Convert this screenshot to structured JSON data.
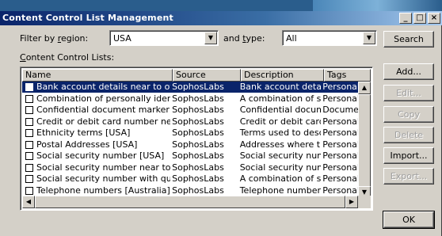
{
  "window": {
    "title": "Content Control List Management",
    "controls": {
      "minimize": "_",
      "maximize": "□",
      "close": "×"
    }
  },
  "filter": {
    "region_label_prefix": "Filter by ",
    "region_label_key": "r",
    "region_label_suffix": "egion:",
    "region_value": "USA",
    "type_label_prefix": "and ",
    "type_label_key": "t",
    "type_label_suffix": "ype:",
    "type_value": "All"
  },
  "list_label": {
    "key": "C",
    "rest": "ontent Control Lists:"
  },
  "columns": [
    "Name",
    "Source",
    "Description",
    "Tags"
  ],
  "rows": [
    {
      "name": "Bank account details near to other f...",
      "source": "SophosLabs",
      "description": "Bank account detail...",
      "tags": "Personally",
      "selected": true
    },
    {
      "name": "Combination of personally identifiab...",
      "source": "SophosLabs",
      "description": "A combination of so...",
      "tags": "Personally"
    },
    {
      "name": "Confidential document marker [USA]",
      "source": "SophosLabs",
      "description": "Confidential docum...",
      "tags": "Document"
    },
    {
      "name": "Credit or debit card number near to...",
      "source": "SophosLabs",
      "description": "Credit or debit card...",
      "tags": "Personally"
    },
    {
      "name": "Ethnicity terms [USA]",
      "source": "SophosLabs",
      "description": "Terms used to desc...",
      "tags": "Personally"
    },
    {
      "name": "Postal Addresses [USA]",
      "source": "SophosLabs",
      "description": "Addresses where t...",
      "tags": "Personally"
    },
    {
      "name": "Social security number [USA]",
      "source": "SophosLabs",
      "description": "Social security num...",
      "tags": "Personally"
    },
    {
      "name": "Social security number near to othe...",
      "source": "SophosLabs",
      "description": "Social security num...",
      "tags": "Personally"
    },
    {
      "name": "Social security number with qualifyi...",
      "source": "SophosLabs",
      "description": "A combination of so...",
      "tags": "Personally"
    },
    {
      "name": "Telephone numbers [Australia]",
      "source": "SophosLabs",
      "description": "Telephone numbers...",
      "tags": "Personally"
    }
  ],
  "buttons": {
    "search": "Search",
    "add": "Add...",
    "edit": "Edit...",
    "copy": "Copy",
    "delete": "Delete",
    "import": "Import...",
    "export": "Export...",
    "ok": "OK"
  },
  "icons": {
    "dropdown": "chevron-down-icon",
    "scroll_up": "arrow-up-icon",
    "scroll_down": "arrow-down-icon",
    "scroll_left": "arrow-left-icon",
    "scroll_right": "arrow-right-icon"
  },
  "colors": {
    "titlebar": "#0a246a",
    "selection": "#0a246a",
    "face": "#d4d0c8"
  }
}
